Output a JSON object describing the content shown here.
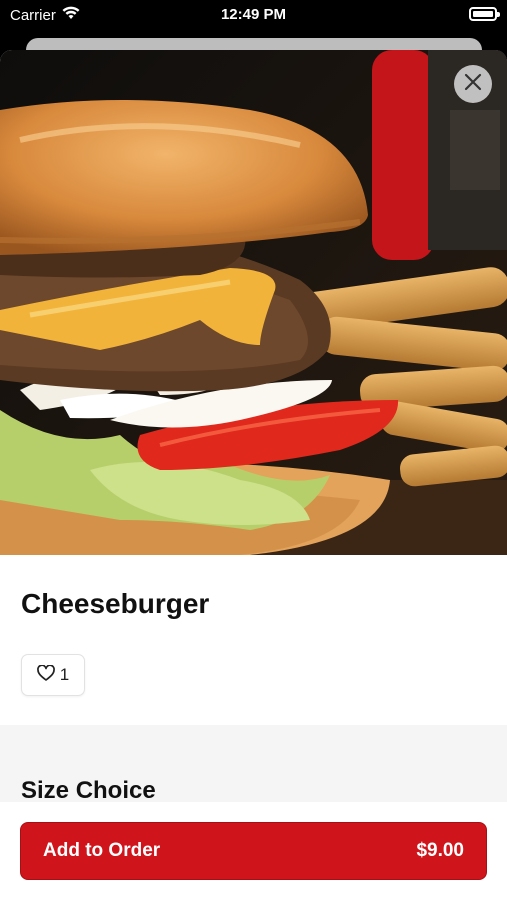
{
  "status_bar": {
    "carrier": "Carrier",
    "time": "12:49 PM"
  },
  "item": {
    "title": "Cheeseburger",
    "like_count": "1",
    "image_subject": "cheeseburger with fries"
  },
  "sections": [
    {
      "title": "Size Choice"
    }
  ],
  "footer": {
    "add_label": "Add to Order",
    "price": "$9.00"
  },
  "colors": {
    "accent": "#d0141b",
    "section_bg": "#f5f5f5"
  }
}
